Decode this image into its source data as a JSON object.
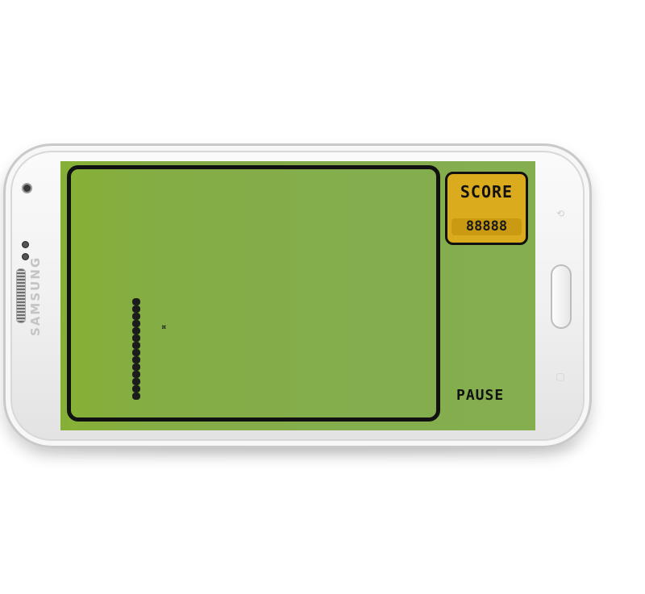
{
  "device": {
    "brand": "SAMSUNG"
  },
  "score": {
    "label": "SCORE",
    "value": "88888"
  },
  "controls": {
    "pause_label": "PAUSE"
  },
  "game": {
    "snake_length": 14,
    "food_glyph": "¤"
  },
  "colors": {
    "screen_green": "#84ad4d",
    "score_gold": "#d9ab1d",
    "snake": "#1c1c1c"
  }
}
